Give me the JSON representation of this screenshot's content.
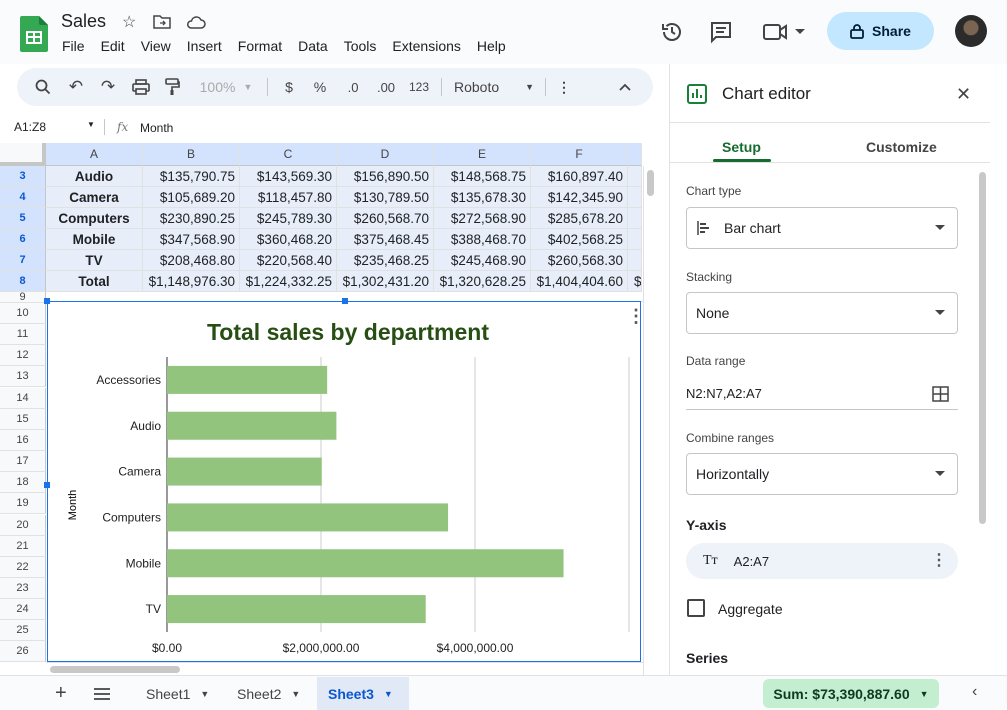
{
  "app": {
    "title": "Sales",
    "menu": [
      "File",
      "Edit",
      "View",
      "Insert",
      "Format",
      "Data",
      "Tools",
      "Extensions",
      "Help"
    ],
    "share_label": "Share"
  },
  "toolbar": {
    "zoom": "100%",
    "currency": "$",
    "percent": "%",
    "dec_decrease": ".0",
    "dec_increase": ".00",
    "number_format": "123",
    "font": "Roboto"
  },
  "formula_bar": {
    "name_box": "A1:Z8",
    "fx": "fx",
    "content": "Month"
  },
  "grid": {
    "columns": [
      "A",
      "B",
      "C",
      "D",
      "E",
      "F"
    ],
    "rows": [
      {
        "num": "3",
        "cells": [
          "Audio",
          "$135,790.75",
          "$143,569.30",
          "$156,890.50",
          "$148,568.75",
          "$160,897.40"
        ]
      },
      {
        "num": "4",
        "cells": [
          "Camera",
          "$105,689.20",
          "$118,457.80",
          "$130,789.50",
          "$135,678.30",
          "$142,345.90"
        ]
      },
      {
        "num": "5",
        "cells": [
          "Computers",
          "$230,890.25",
          "$245,789.30",
          "$260,568.70",
          "$272,568.90",
          "$285,678.20"
        ]
      },
      {
        "num": "6",
        "cells": [
          "Mobile",
          "$347,568.90",
          "$360,468.20",
          "$375,468.45",
          "$388,468.70",
          "$402,568.25"
        ]
      },
      {
        "num": "7",
        "cells": [
          "TV",
          "$208,468.80",
          "$220,568.40",
          "$235,468.25",
          "$245,468.90",
          "$260,568.30"
        ]
      },
      {
        "num": "8",
        "cells": [
          "Total",
          "$1,148,976.30",
          "$1,224,332.25",
          "$1,302,431.20",
          "$1,320,628.25",
          "$1,404,404.60"
        ]
      }
    ],
    "overflow_char": "$",
    "lower_rows": [
      "9",
      "10",
      "11",
      "12",
      "13",
      "14",
      "15",
      "16",
      "17",
      "18",
      "19",
      "20",
      "21",
      "22",
      "23",
      "24",
      "25",
      "26"
    ]
  },
  "chart_data": {
    "type": "bar",
    "orientation": "horizontal",
    "title": "Total sales by department",
    "ylabel": "Month",
    "xlabel": "",
    "categories": [
      "Accessories",
      "Audio",
      "Camera",
      "Computers",
      "Mobile",
      "TV"
    ],
    "values": [
      2080000,
      2200000,
      2010000,
      3650000,
      5150000,
      3360000
    ],
    "xlim": [
      0,
      6000000
    ],
    "x_ticks": [
      "$0.00",
      "$2,000,000.00",
      "$4,000,000.00"
    ],
    "x_tick_values": [
      0,
      2000000,
      4000000
    ],
    "bar_color": "#93c47d",
    "title_color": "#274e13",
    "grid": true
  },
  "editor": {
    "title": "Chart editor",
    "tabs": {
      "setup": "Setup",
      "customize": "Customize"
    },
    "chart_type_label": "Chart type",
    "chart_type_value": "Bar chart",
    "stacking_label": "Stacking",
    "stacking_value": "None",
    "data_range_label": "Data range",
    "data_range_value": "N2:N7,A2:A7",
    "combine_label": "Combine ranges",
    "combine_value": "Horizontally",
    "yaxis_label": "Y-axis",
    "yaxis_value": "A2:A7",
    "aggregate_label": "Aggregate",
    "series_label": "Series"
  },
  "bottom": {
    "sheets": [
      "Sheet1",
      "Sheet2",
      "Sheet3"
    ],
    "active_sheet": "Sheet3",
    "sum": "Sum: $73,390,887.60"
  },
  "colors": {
    "accent": "#0b57d0",
    "share_bg": "#c2e7ff",
    "sum_bg": "#c4eed0",
    "sheet_active_bg": "#e1e9f7"
  }
}
